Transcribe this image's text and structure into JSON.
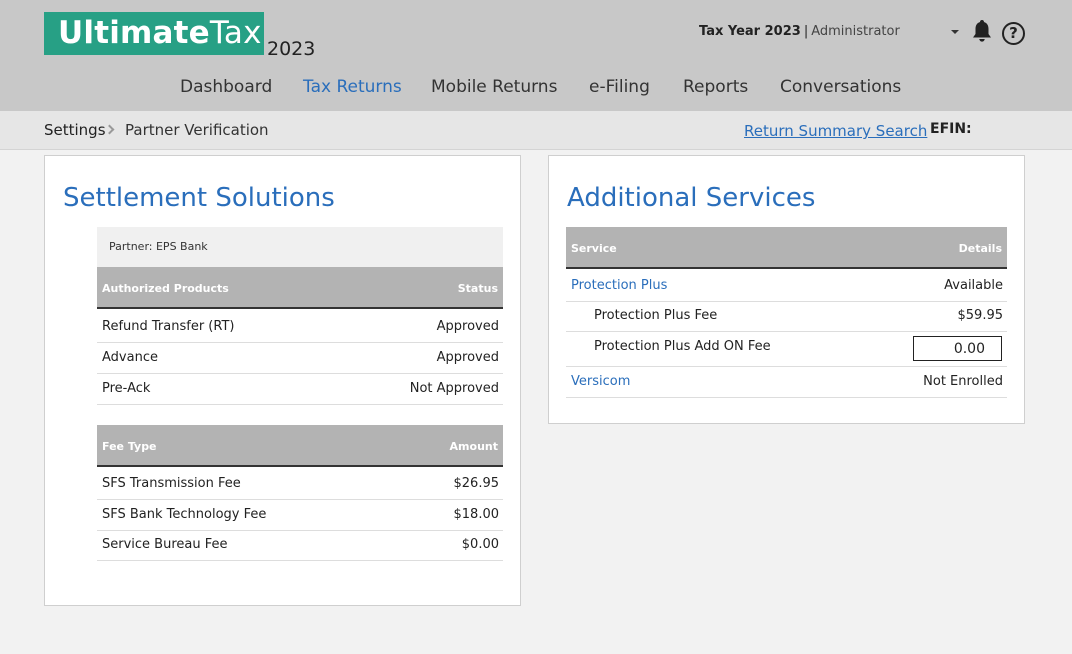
{
  "header": {
    "logo_bold": "Ultimate",
    "logo_light": "Tax",
    "logo_year": "2023",
    "tax_year_label": "Tax Year 2023",
    "separator": "|",
    "user_role": "Administrator",
    "help_glyph": "?"
  },
  "nav": {
    "items": [
      "Dashboard",
      "Tax Returns",
      "Mobile Returns",
      "e-Filing",
      "Reports",
      "Conversations"
    ],
    "active": "Tax Returns"
  },
  "breadcrumb": {
    "root": "Settings",
    "current": "Partner Verification",
    "return_summary_link": "Return Summary Search",
    "efin_label": "EFIN:"
  },
  "settlement": {
    "title": "Settlement Solutions",
    "partner": "Partner: EPS Bank",
    "products_header": {
      "left": "Authorized Products",
      "right": "Status"
    },
    "products": [
      {
        "name": "Refund Transfer (RT)",
        "status": "Approved"
      },
      {
        "name": "Advance",
        "status": "Approved"
      },
      {
        "name": "Pre-Ack",
        "status": "Not Approved"
      }
    ],
    "fees_header": {
      "left": "Fee Type",
      "right": "Amount"
    },
    "fees": [
      {
        "name": "SFS Transmission Fee",
        "amount": "$26.95"
      },
      {
        "name": "SFS Bank Technology Fee",
        "amount": "$18.00"
      },
      {
        "name": "Service Bureau Fee",
        "amount": "$0.00"
      }
    ]
  },
  "additional": {
    "title": "Additional Services",
    "header": {
      "left": "Service",
      "right": "Details"
    },
    "protection_plus": {
      "name": "Protection Plus",
      "status": "Available"
    },
    "protection_plus_fee": {
      "name": "Protection Plus Fee",
      "amount": "$59.95"
    },
    "protection_plus_addon": {
      "name": "Protection Plus Add ON Fee",
      "value": "0.00"
    },
    "versicom": {
      "name": "Versicom",
      "status": "Not Enrolled"
    }
  },
  "colors": {
    "brand_green": "#27a085",
    "link_blue": "#2a6ebb",
    "header_gray": "#c8c8c8",
    "table_header_gray": "#b3b3b3"
  },
  "icons": [
    "bell-icon",
    "help-icon",
    "caret-down-icon",
    "chevron-right-icon"
  ]
}
